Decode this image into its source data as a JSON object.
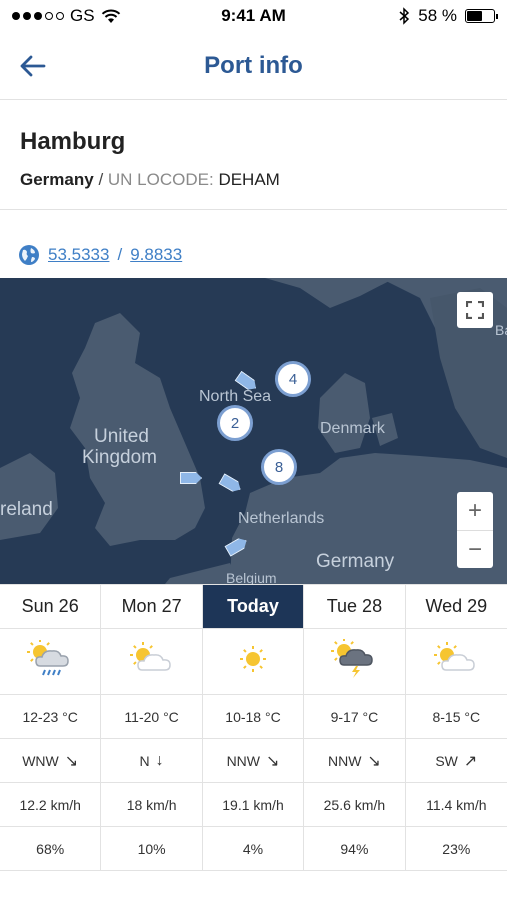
{
  "status": {
    "carrier": "GS",
    "time": "9:41 AM",
    "battery": "58 %",
    "battery_level": 0.58
  },
  "nav": {
    "title": "Port info"
  },
  "port": {
    "name": "Hamburg",
    "country": "Germany",
    "separator": "/",
    "locode_label": "UN LOCODE:",
    "locode": "DEHAM",
    "lat": "53.5333",
    "lon": "9.8833",
    "coord_separator": "/"
  },
  "map": {
    "labels": {
      "north_sea": "North Sea",
      "united": "United",
      "kingdom": "Kingdom",
      "denmark": "Denmark",
      "ireland": "reland",
      "netherlands": "Netherlands",
      "germany": "Germany",
      "belgium": "Belgium",
      "edge": "Ba"
    },
    "clusters": [
      "4",
      "2",
      "8"
    ],
    "zoom_in": "+",
    "zoom_out": "−"
  },
  "forecast": {
    "days": [
      {
        "label": "Sun 26",
        "weather": "cloud-rain",
        "temp": "12-23 °C",
        "wind_dir": "WNW",
        "wind_arrow": "↘",
        "wind_speed": "12.2 km/h",
        "precip": "68%"
      },
      {
        "label": "Mon 27",
        "weather": "partly-cloudy",
        "temp": "11-20 °C",
        "wind_dir": "N",
        "wind_arrow": "↓",
        "wind_speed": "18 km/h",
        "precip": "10%"
      },
      {
        "label": "Today",
        "weather": "sunny",
        "temp": "10-18 °C",
        "wind_dir": "NNW",
        "wind_arrow": "↘",
        "wind_speed": "19.1 km/h",
        "precip": "4%"
      },
      {
        "label": "Tue 28",
        "weather": "thunderstorm",
        "temp": "9-17 °C",
        "wind_dir": "NNW",
        "wind_arrow": "↘",
        "wind_speed": "25.6 km/h",
        "precip": "94%"
      },
      {
        "label": "Wed 29",
        "weather": "partly-cloudy",
        "temp": "8-15 °C",
        "wind_dir": "SW",
        "wind_arrow": "↗",
        "wind_speed": "11.4 km/h",
        "precip": "23%"
      }
    ]
  },
  "colors": {
    "accent": "#2c5994",
    "link": "#3f7fc6",
    "today_bg": "#1d3557",
    "map_water": "#263a55",
    "map_land": "#4a5b70"
  }
}
